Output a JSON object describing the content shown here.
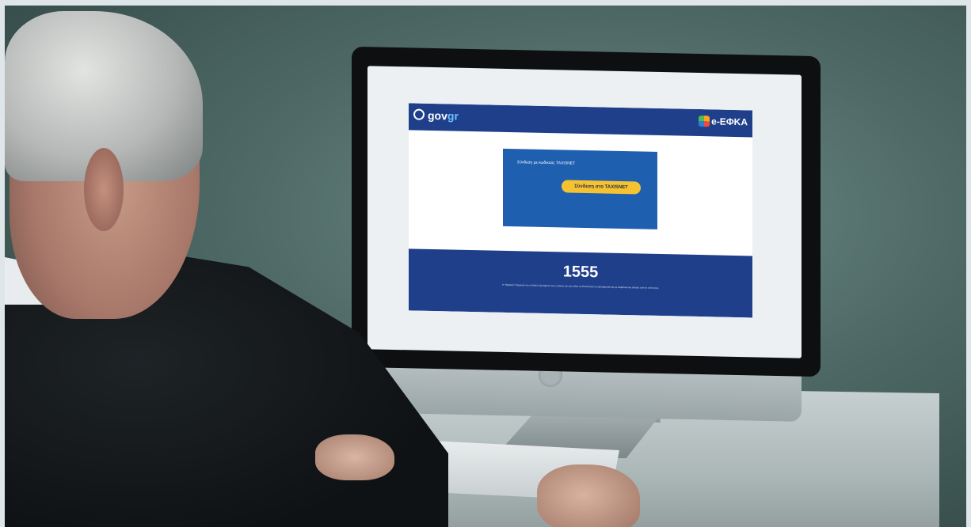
{
  "scene": {
    "description_colors": {
      "wall": "#4d6864",
      "site_blue": "#1f3f8b",
      "login_panel": "#1f5fb0",
      "login_button": "#f5c232"
    }
  },
  "site": {
    "header": {
      "gov_logo_main": "gov",
      "gov_logo_suffix": "gr",
      "efka_logo": "e-ΕΦΚΑ"
    },
    "login": {
      "prompt": "Σύνδεση με κωδικούς TAXISNET",
      "button_label": "Σύνδεση στο TAXISNET"
    },
    "footer": {
      "phone": "1555",
      "note": "Η Ψηφιακή Υπηρεσία του e-ΕΦΚΑ εξυπηρετεί τους πολίτες και τους δίνει τη δυνατότητα να εξυπηρετούνται με ασφάλεια και εύκολα από το σπίτι τους."
    }
  }
}
